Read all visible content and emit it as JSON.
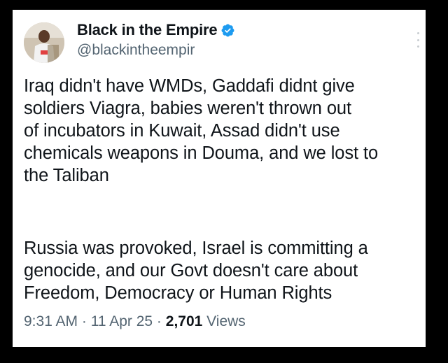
{
  "author": {
    "display_name": "Black in the Empire",
    "handle": "@blackintheempir",
    "verified_icon": "verified-badge-icon",
    "badge_color": "#1d9bf0"
  },
  "tweet": {
    "paragraph_1": "Iraq didn't have WMDs, Gaddafi didnt give\nsoldiers Viagra, babies weren't thrown out\nof incubators in Kuwait, Assad didn't use\nchemicals weapons in Douma, and we lost to\nthe Taliban",
    "paragraph_2": "Russia was provoked, Israel is committing a\ngenocide, and our Govt doesn't care about\nFreedom, Democracy or Human Rights"
  },
  "meta": {
    "time": "9:31 AM",
    "separator": " · ",
    "date": "11 Apr 25",
    "views_count": "2,701",
    "views_label": " Views"
  },
  "more_icon": "more-options-icon"
}
